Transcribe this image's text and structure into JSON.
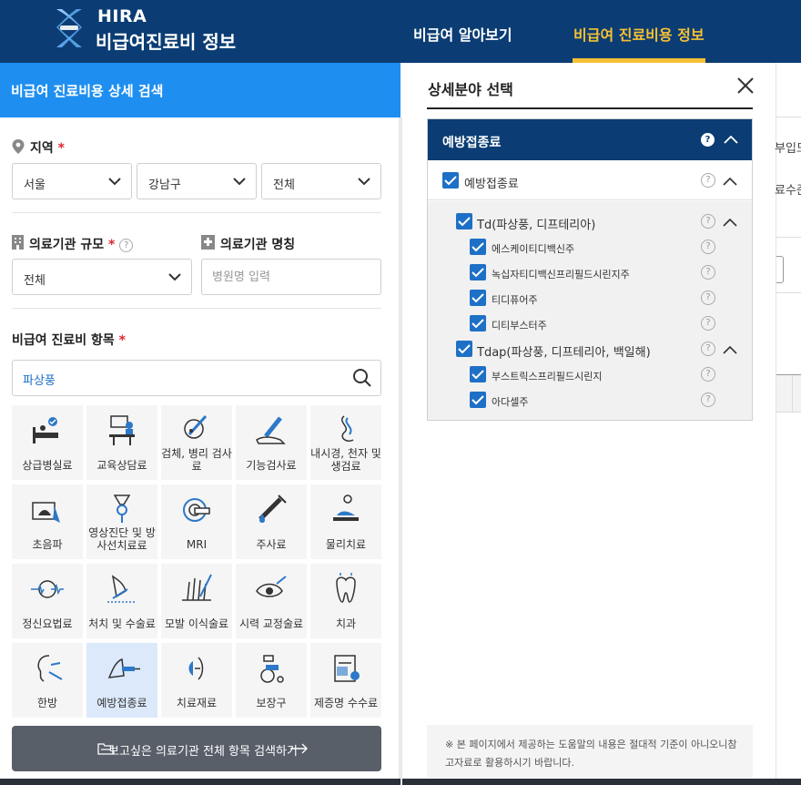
{
  "header": {
    "brand": "HIRA",
    "site_name": "비급여진료비 정보",
    "nav": [
      {
        "label": "비급여 알아보기"
      },
      {
        "label": "비급여 진료비용 정보"
      }
    ],
    "active_nav_index": 1,
    "colors": {
      "bar": "#0b3d74",
      "active": "#f7c034"
    }
  },
  "search": {
    "title": "비급여 진료비용 상세 검색",
    "region": {
      "label": "지역",
      "required_mark": "*",
      "selects": [
        "서울",
        "강남구",
        "전체"
      ]
    },
    "scale": {
      "label": "의료기관 규모",
      "required_mark": "*",
      "help": "?",
      "value": "전체"
    },
    "name": {
      "label": "의료기관 명칭",
      "placeholder": "병원명 입력"
    },
    "items": {
      "label": "비급여 진료비 항목",
      "required_mark": "*",
      "query": "파상풍"
    },
    "categories": [
      {
        "label": "상급병실료",
        "icon": "hospital-bed-icon"
      },
      {
        "label": "교육상담료",
        "icon": "counseling-icon"
      },
      {
        "label": "검체, 병리 검사료",
        "icon": "pathology-icon"
      },
      {
        "label": "기능검사료",
        "icon": "function-test-icon"
      },
      {
        "label": "내시경, 천자 및 생검료",
        "icon": "endoscope-icon"
      },
      {
        "label": "초음파",
        "icon": "ultrasound-icon"
      },
      {
        "label": "영상진단 및 방사선치료료",
        "icon": "radiology-icon"
      },
      {
        "label": "MRI",
        "icon": "mri-icon"
      },
      {
        "label": "주사료",
        "icon": "syringe-icon"
      },
      {
        "label": "물리치료",
        "icon": "physical-therapy-icon"
      },
      {
        "label": "정신요법료",
        "icon": "brain-icon"
      },
      {
        "label": "처치 및 수술료",
        "icon": "surgery-icon"
      },
      {
        "label": "모발 이식술료",
        "icon": "hair-transplant-icon"
      },
      {
        "label": "시력 교정술료",
        "icon": "eye-icon"
      },
      {
        "label": "치과",
        "icon": "tooth-icon"
      },
      {
        "label": "한방",
        "icon": "acupuncture-icon"
      },
      {
        "label": "예방접종료",
        "icon": "vaccination-icon",
        "selected": true
      },
      {
        "label": "치료재료",
        "icon": "treatment-material-icon"
      },
      {
        "label": "보장구",
        "icon": "wheelchair-icon"
      },
      {
        "label": "제증명 수수료",
        "icon": "certificate-icon"
      }
    ],
    "submit_label": "보고싶은 의료기관 전체 항목 검색하기"
  },
  "detail_modal": {
    "title": "상세분야 선택",
    "group_header": "예방접종료",
    "group_help": "?",
    "level1": {
      "label": "예방접종료",
      "checked": true
    },
    "subgroups": [
      {
        "label": "Td(파상풍, 디프테리아)",
        "checked": true,
        "children": [
          {
            "label": "에스케이티디백신주",
            "checked": true
          },
          {
            "label": "녹십자티디백신프리필드시린지주",
            "checked": true
          },
          {
            "label": "티디퓨어주",
            "checked": true
          },
          {
            "label": "디티부스터주",
            "checked": true
          }
        ]
      },
      {
        "label": "Tdap(파상풍, 디프테리아, 백일해)",
        "checked": true,
        "children": [
          {
            "label": "부스트릭스프리필드시린지",
            "checked": true
          },
          {
            "label": "아다셀주",
            "checked": true
          }
        ]
      }
    ],
    "notice": "※ 본 페이지에서 제공하는 도움말의 내용은 절대적 기준이 아니오니참고자료로 활용하시기 바랍니다."
  },
  "background_page": {
    "text1": "부입도",
    "text2": "료수준"
  }
}
